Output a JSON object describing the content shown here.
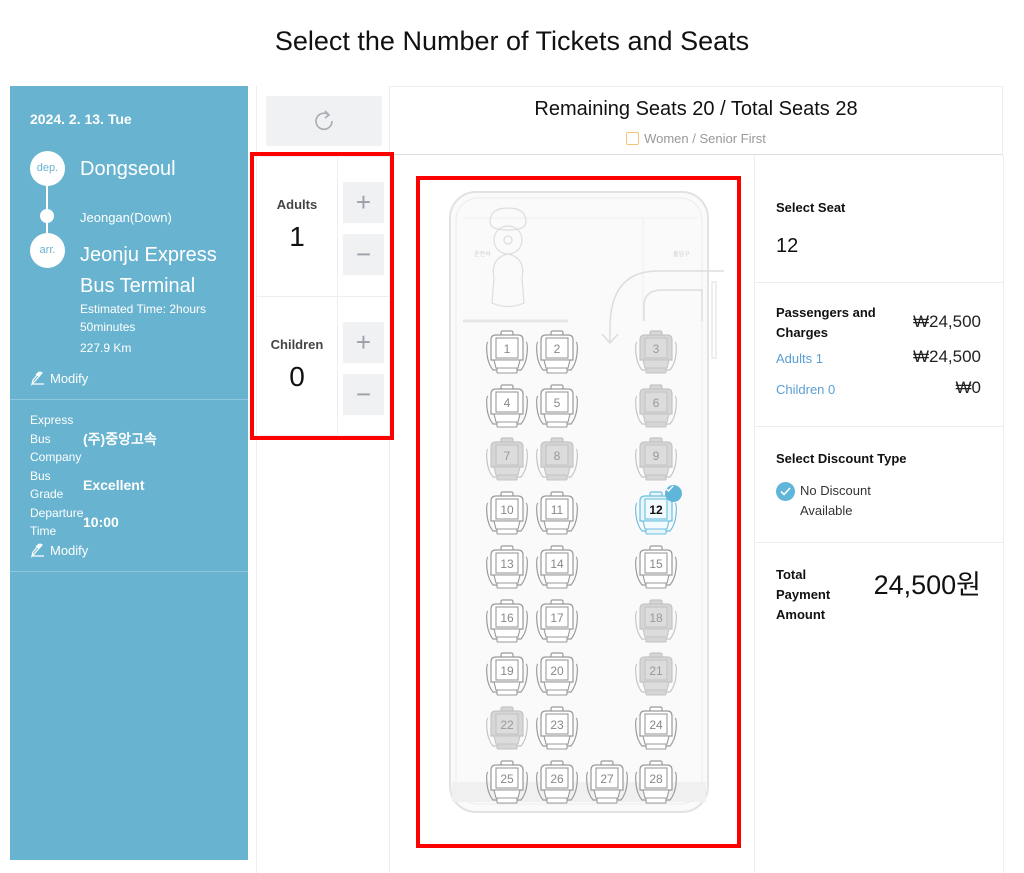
{
  "page": {
    "title": "Select the Number of Tickets and Seats"
  },
  "sidebar": {
    "date": "2024. 2. 13. Tue",
    "departure_badge": "dep.",
    "departure": "Dongseoul",
    "via": "Jeongan(Down)",
    "arrival_badge": "arr.",
    "arrival": "Jeonju Express Bus Terminal",
    "estimated_time": "Estimated Time: 2hours 50minutes",
    "distance": "227.9 Km",
    "modify_label": "Modify",
    "info": [
      {
        "label": "Express Bus Company",
        "value": "(주)중앙고속"
      },
      {
        "label": "Bus Grade",
        "value": "Excellent"
      },
      {
        "label": "Departure Time",
        "value": "10:00"
      }
    ],
    "modify_label_2": "Modify"
  },
  "counters": {
    "refresh_icon": "refresh-icon",
    "adults": {
      "label": "Adults",
      "value": "1",
      "plus": "+",
      "minus": "−"
    },
    "children": {
      "label": "Children",
      "value": "0",
      "plus": "+",
      "minus": "−"
    }
  },
  "seat_header": {
    "remaining": "Remaining Seats 20 / Total Seats 28",
    "legend": "Women / Senior First",
    "legend_color": "#f5c27a"
  },
  "seats": {
    "total": 28,
    "remaining": 20,
    "reserved": [
      3,
      6,
      7,
      8,
      9,
      18,
      21,
      22
    ],
    "selected": [
      12
    ],
    "driver_label": "운전석",
    "door_label": "출입구",
    "selected_color": "#5fb6d9"
  },
  "summary": {
    "select_seat_title": "Select Seat",
    "selected_seat": "12",
    "passengers_title": "Passengers and Charges",
    "passengers_total": "₩24,500",
    "adults_label": "Adults 1",
    "adults_price": "₩24,500",
    "children_label": "Children 0",
    "children_price": "₩0",
    "discount_title": "Select Discount Type",
    "discount_option": "No Discount Available",
    "total_title": "Total Payment Amount",
    "total_value": "24,500원"
  }
}
